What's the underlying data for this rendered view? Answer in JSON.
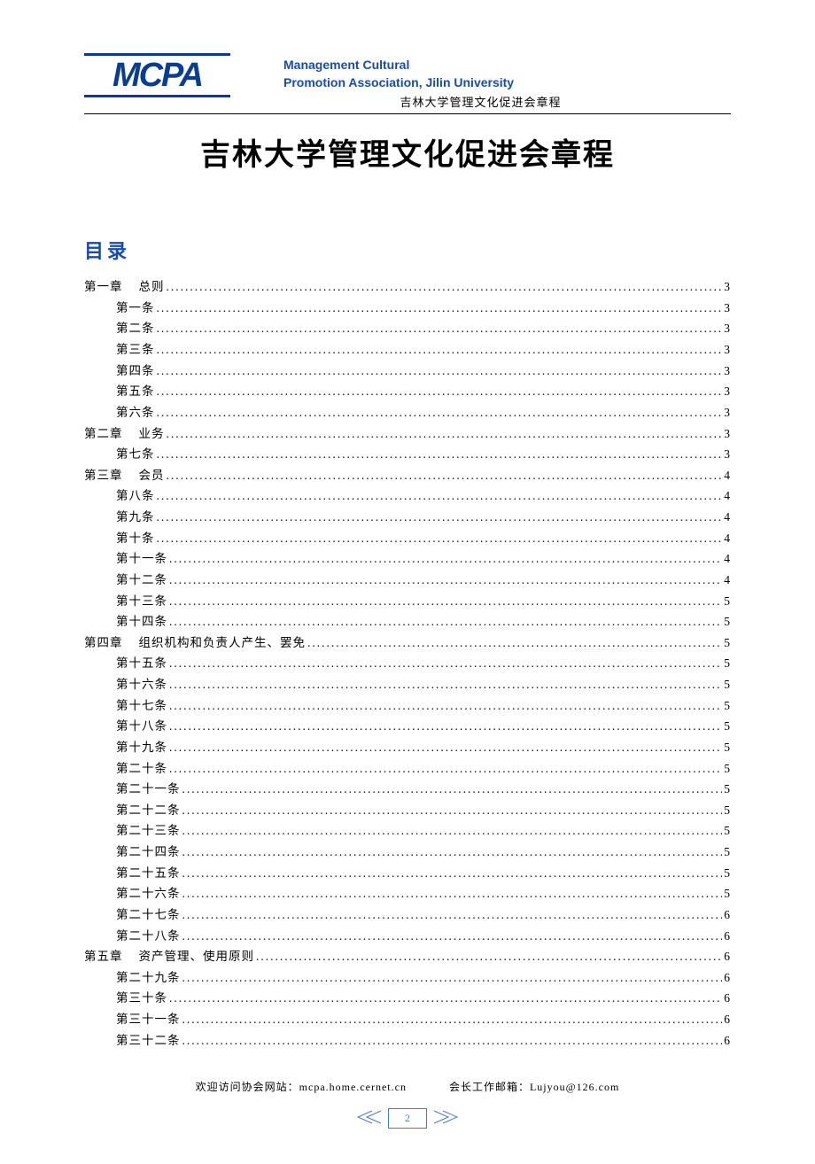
{
  "header": {
    "logo_text": "MCPA",
    "en_line1": "Management Cultural",
    "en_line2": "Promotion Association, Jilin University",
    "cn_subtitle": "吉林大学管理文化促进会章程"
  },
  "main_title": "吉林大学管理文化促进会章程",
  "toc_heading": "目录",
  "toc": [
    {
      "level": 1,
      "label": "第一章",
      "suffix": "总则",
      "page": "3"
    },
    {
      "level": 2,
      "label": "第一条",
      "page": "3"
    },
    {
      "level": 2,
      "label": "第二条",
      "page": "3"
    },
    {
      "level": 2,
      "label": "第三条",
      "page": "3"
    },
    {
      "level": 2,
      "label": "第四条",
      "page": "3"
    },
    {
      "level": 2,
      "label": "第五条",
      "page": "3"
    },
    {
      "level": 2,
      "label": "第六条",
      "page": "3"
    },
    {
      "level": 1,
      "label": "第二章",
      "suffix": "业务",
      "page": "3"
    },
    {
      "level": 2,
      "label": "第七条",
      "page": "3"
    },
    {
      "level": 1,
      "label": "第三章",
      "suffix": "会员",
      "page": "4"
    },
    {
      "level": 2,
      "label": "第八条",
      "page": "4"
    },
    {
      "level": 2,
      "label": "第九条",
      "page": "4"
    },
    {
      "level": 2,
      "label": "第十条",
      "page": "4"
    },
    {
      "level": 2,
      "label": "第十一条",
      "page": "4"
    },
    {
      "level": 2,
      "label": "第十二条",
      "page": "4"
    },
    {
      "level": 2,
      "label": "第十三条",
      "page": "5"
    },
    {
      "level": 2,
      "label": "第十四条",
      "page": "5"
    },
    {
      "level": 1,
      "label": "第四章",
      "suffix": "组织机构和负责人产生、罢免",
      "page": "5"
    },
    {
      "level": 2,
      "label": "第十五条",
      "page": "5"
    },
    {
      "level": 2,
      "label": "第十六条",
      "page": "5"
    },
    {
      "level": 2,
      "label": "第十七条",
      "page": "5"
    },
    {
      "level": 2,
      "label": "第十八条",
      "page": "5"
    },
    {
      "level": 2,
      "label": "第十九条",
      "page": "5"
    },
    {
      "level": 2,
      "label": "第二十条",
      "page": "5"
    },
    {
      "level": 2,
      "label": "第二十一条",
      "page": "5"
    },
    {
      "level": 2,
      "label": "第二十二条",
      "page": "5"
    },
    {
      "level": 2,
      "label": "第二十三条",
      "page": "5"
    },
    {
      "level": 2,
      "label": "第二十四条",
      "page": "5"
    },
    {
      "level": 2,
      "label": "第二十五条",
      "page": "5"
    },
    {
      "level": 2,
      "label": "第二十六条",
      "page": "5"
    },
    {
      "level": 2,
      "label": "第二十七条",
      "page": "6"
    },
    {
      "level": 2,
      "label": "第二十八条",
      "page": "6"
    },
    {
      "level": 1,
      "label": "第五章",
      "suffix": "资产管理、使用原则",
      "page": "6"
    },
    {
      "level": 2,
      "label": "第二十九条",
      "page": "6"
    },
    {
      "level": 2,
      "label": "第三十条",
      "page": "6"
    },
    {
      "level": 2,
      "label": "第三十一条",
      "page": "6"
    },
    {
      "level": 2,
      "label": "第三十二条",
      "page": "6"
    }
  ],
  "footer": {
    "website_label": "欢迎访问协会网站：",
    "website_value": "mcpa.home.cernet.cn",
    "email_label": "会长工作邮箱：",
    "email_value": "Lujyou@126.com",
    "page_number": "2"
  }
}
